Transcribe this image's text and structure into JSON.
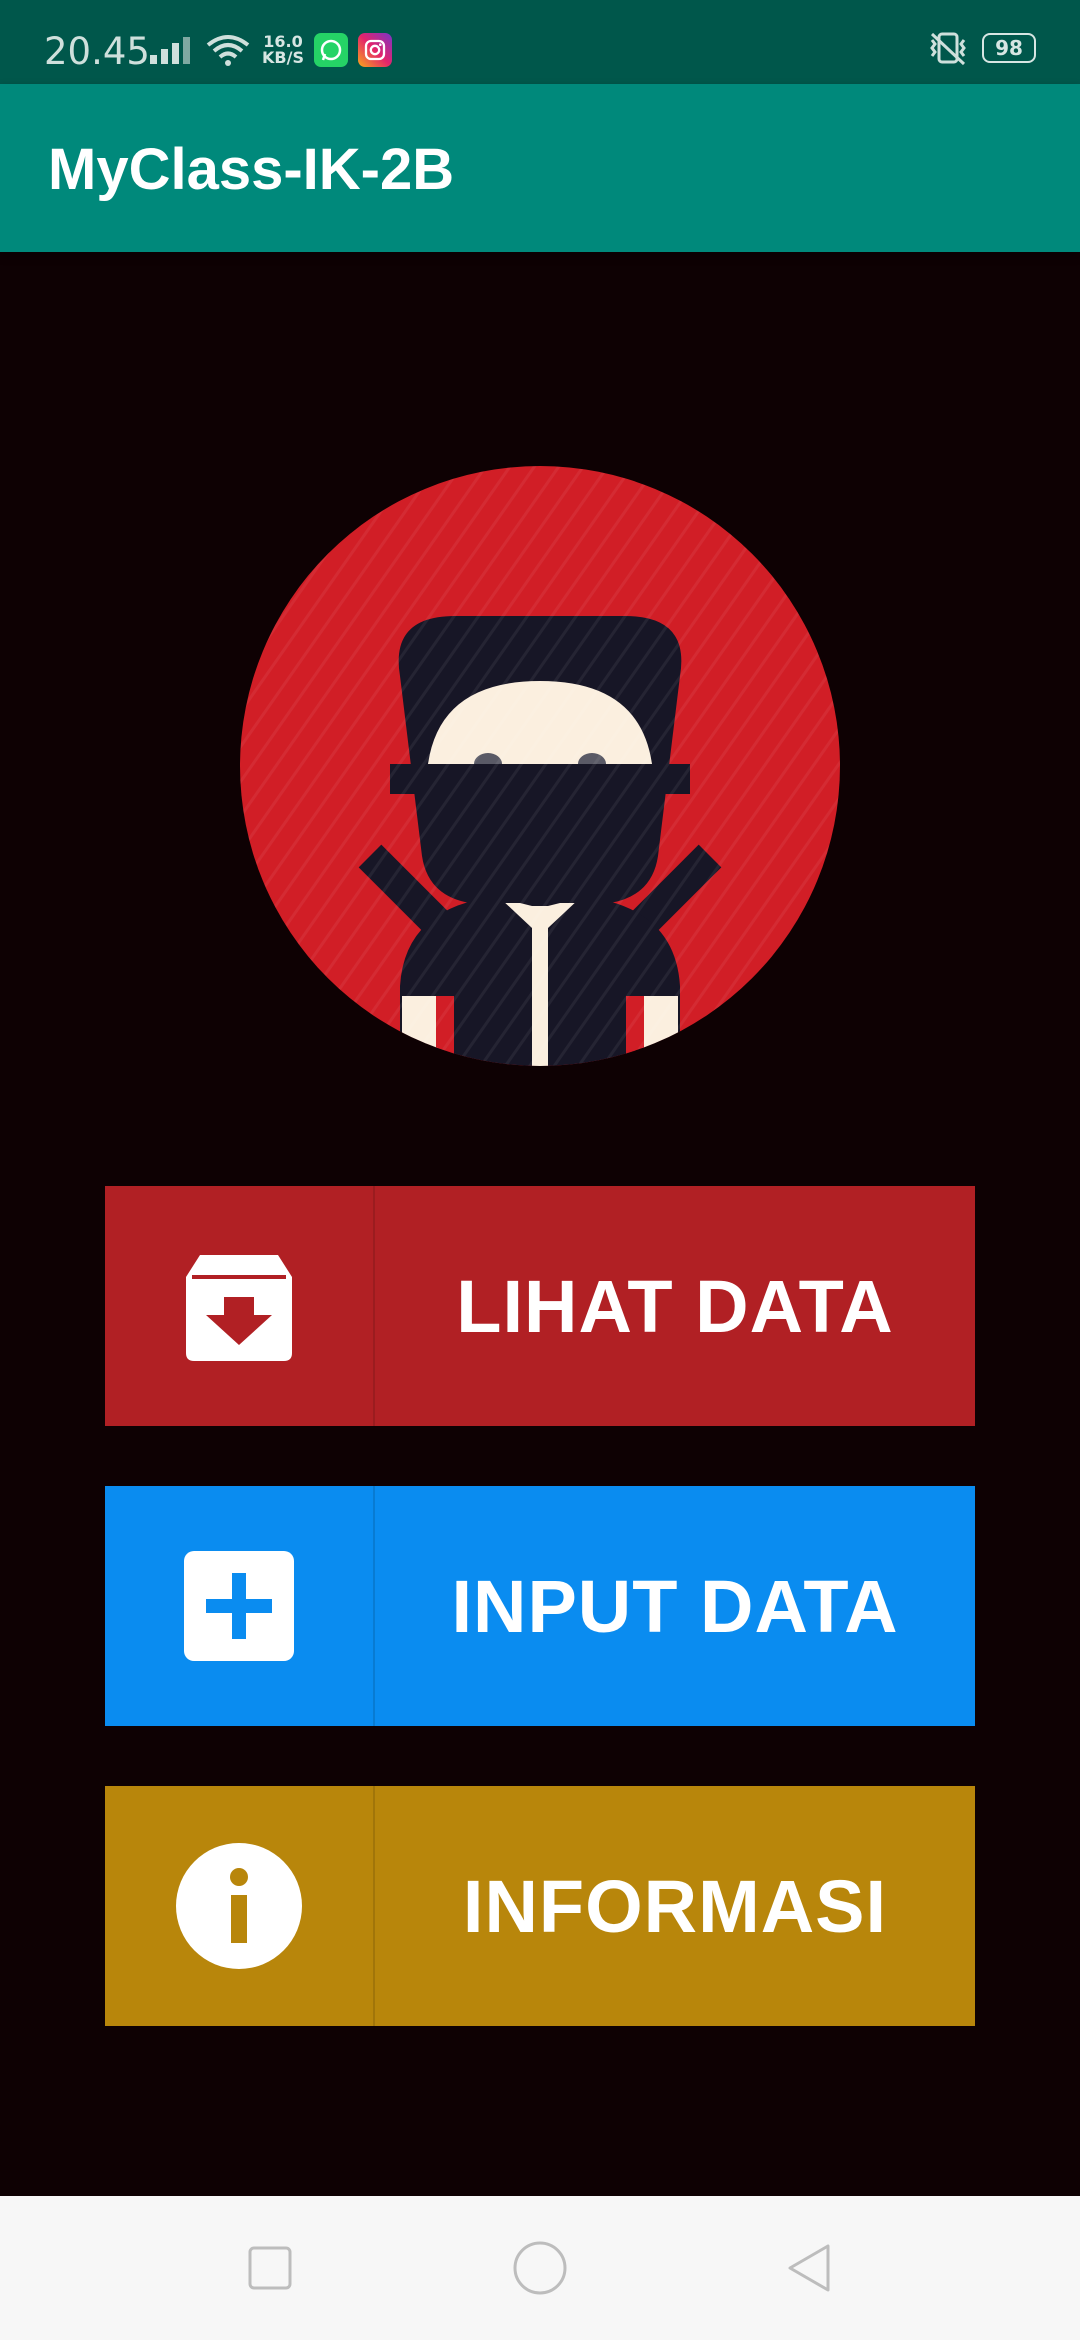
{
  "status_bar": {
    "time": "20.45",
    "net_speed_value": "16.0",
    "net_speed_unit": "KB/S",
    "battery": "98",
    "icons": [
      "signal-icon",
      "wifi-icon",
      "whatsapp-icon",
      "instagram-icon",
      "vibrate-icon",
      "battery-icon"
    ]
  },
  "app_bar": {
    "title": "MyClass-IK-2B",
    "color": "#00897b"
  },
  "hero": {
    "image": "ninja-avatar-icon",
    "circle_color": "#d11e26"
  },
  "menu": {
    "lihat_data": {
      "label": "LIHAT DATA",
      "icon": "archive-download-icon",
      "color": "#b12024"
    },
    "input_data": {
      "label": "INPUT DATA",
      "icon": "add-box-icon",
      "color": "#0a8cf0"
    },
    "informasi": {
      "label": "INFORMASI",
      "icon": "info-icon",
      "color": "#b8860b"
    }
  },
  "nav_bar": {
    "buttons": [
      "recents-square-icon",
      "home-circle-icon",
      "back-triangle-icon"
    ]
  }
}
